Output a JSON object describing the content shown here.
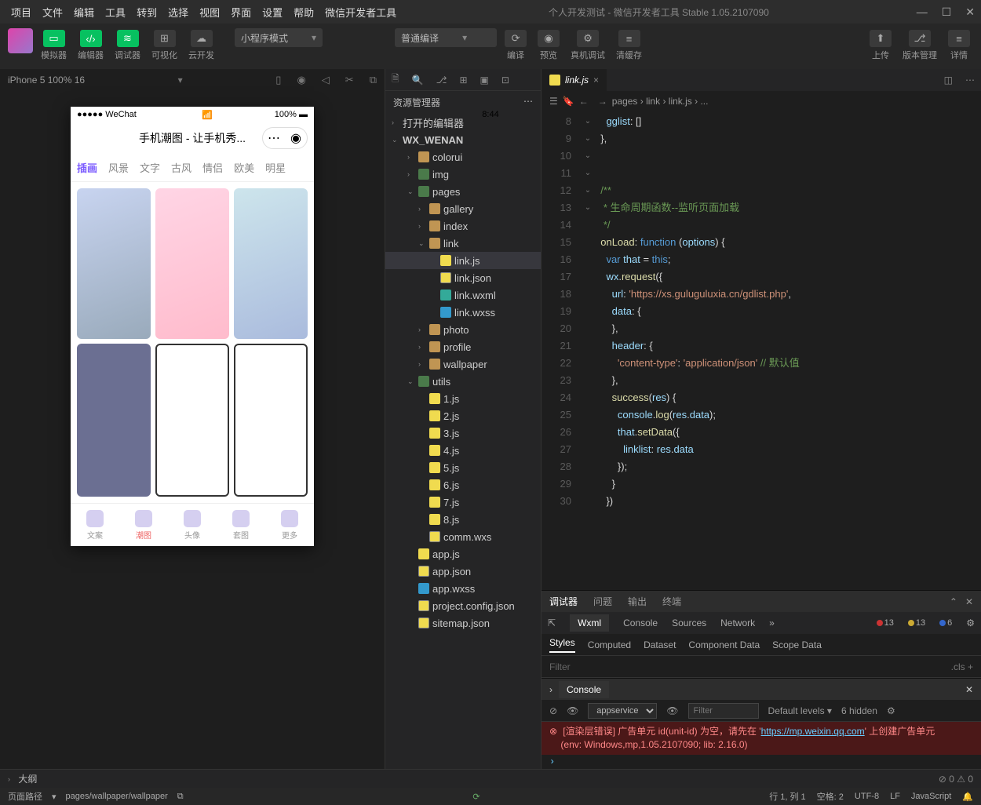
{
  "menus": [
    "项目",
    "文件",
    "编辑",
    "工具",
    "转到",
    "选择",
    "视图",
    "界面",
    "设置",
    "帮助",
    "微信开发者工具"
  ],
  "title": "个人开发测试 - 微信开发者工具 Stable 1.05.2107090",
  "toolbar": {
    "sim": "模拟器",
    "editor": "编辑器",
    "debugger": "调试器",
    "vis": "可视化",
    "cloud": "云开发",
    "mode": "小程序模式",
    "compile_mode": "普通编译",
    "compile": "编译",
    "preview": "预览",
    "remote": "真机调试",
    "clear": "清缓存",
    "upload": "上传",
    "version": "版本管理",
    "detail": "详情"
  },
  "sim": {
    "device": "iPhone 5 100% 16",
    "wechat": "●●●●● WeChat",
    "time": "8:44",
    "batt": "100%",
    "app_title": "手机潮图 - 让手机秀...",
    "tabs": [
      "插画",
      "风景",
      "文字",
      "古风",
      "情侣",
      "欧美",
      "明星"
    ],
    "nav": [
      "文案",
      "潮图",
      "头像",
      "套图",
      "更多"
    ]
  },
  "explorer": {
    "title": "资源管理器",
    "open": "打开的编辑器",
    "root": "WX_WENAN",
    "items": [
      {
        "n": "colorui",
        "t": "fold",
        "d": 2
      },
      {
        "n": "img",
        "t": "foldg",
        "d": 2
      },
      {
        "n": "pages",
        "t": "foldg",
        "d": 2,
        "o": 1
      },
      {
        "n": "gallery",
        "t": "fold",
        "d": 3
      },
      {
        "n": "index",
        "t": "fold",
        "d": 3
      },
      {
        "n": "link",
        "t": "fold",
        "d": 3,
        "o": 1
      },
      {
        "n": "link.js",
        "t": "js",
        "d": 4,
        "sel": 1
      },
      {
        "n": "link.json",
        "t": "json",
        "d": 4
      },
      {
        "n": "link.wxml",
        "t": "wxml",
        "d": 4
      },
      {
        "n": "link.wxss",
        "t": "wxss",
        "d": 4
      },
      {
        "n": "photo",
        "t": "fold",
        "d": 3
      },
      {
        "n": "profile",
        "t": "fold",
        "d": 3
      },
      {
        "n": "wallpaper",
        "t": "fold",
        "d": 3
      },
      {
        "n": "utils",
        "t": "foldg",
        "d": 2,
        "o": 1
      },
      {
        "n": "1.js",
        "t": "js",
        "d": 3
      },
      {
        "n": "2.js",
        "t": "js",
        "d": 3
      },
      {
        "n": "3.js",
        "t": "js",
        "d": 3
      },
      {
        "n": "4.js",
        "t": "js",
        "d": 3
      },
      {
        "n": "5.js",
        "t": "js",
        "d": 3
      },
      {
        "n": "6.js",
        "t": "js",
        "d": 3
      },
      {
        "n": "7.js",
        "t": "js",
        "d": 3
      },
      {
        "n": "8.js",
        "t": "js",
        "d": 3
      },
      {
        "n": "comm.wxs",
        "t": "json",
        "d": 3
      },
      {
        "n": "app.js",
        "t": "js",
        "d": 2
      },
      {
        "n": "app.json",
        "t": "json",
        "d": 2
      },
      {
        "n": "app.wxss",
        "t": "wxss",
        "d": 2
      },
      {
        "n": "project.config.json",
        "t": "json",
        "d": 2
      },
      {
        "n": "sitemap.json",
        "t": "json",
        "d": 2
      }
    ],
    "outline": "大纲"
  },
  "tab": {
    "name": "link.js"
  },
  "crumb": [
    "pages",
    "link",
    "link.js",
    "..."
  ],
  "code": {
    "start": 8,
    "lines": [
      "    <span class='v'>gglist</span>: []",
      "  },",
      "",
      "",
      "  <span class='c'>/**</span>",
      "<span class='c'>   * 生命周期函数--监听页面加载</span>",
      "<span class='c'>   */</span>",
      "  <span class='f'>onLoad</span>: <span class='k'>function</span> (<span class='v'>options</span>) {",
      "    <span class='k'>var</span> <span class='v'>that</span> = <span class='k'>this</span>;",
      "    <span class='v'>wx</span>.<span class='f'>request</span>({",
      "      <span class='v'>url</span>: <span class='s'>'https://xs.guluguluxia.cn/gdlist.php'</span>,",
      "      <span class='v'>data</span>: {",
      "      },",
      "      <span class='v'>header</span>: {",
      "        <span class='s'>'content-type'</span>: <span class='s'>'application/json'</span> <span class='c'>// 默认值</span>",
      "      },",
      "      <span class='f'>success</span>(<span class='v'>res</span>) {",
      "        <span class='v'>console</span>.<span class='f'>log</span>(<span class='v'>res</span>.<span class='v'>data</span>);",
      "        <span class='v'>that</span>.<span class='f'>setData</span>({",
      "          <span class='v'>linklist</span>: <span class='v'>res</span>.<span class='v'>data</span>",
      "        });",
      "      }",
      "    })"
    ]
  },
  "debug": {
    "tabs": [
      "调试器",
      "问题",
      "输出",
      "终端"
    ],
    "dev": [
      "Wxml",
      "Console",
      "Sources",
      "Network"
    ],
    "badges": {
      "err": "13",
      "warn": "13",
      "info": "6"
    },
    "styles": [
      "Styles",
      "Computed",
      "Dataset",
      "Component Data",
      "Scope Data"
    ],
    "filter": "Filter",
    "cls": ".cls"
  },
  "console": {
    "title": "Console",
    "context": "appservice",
    "filter": "Filter",
    "levels": "Default levels",
    "hidden": "6 hidden",
    "err1": "[渲染层错误] 广告单元 id(unit-id) 为空，请先在 '",
    "err_link": "https://mp.weixin.qq.com",
    "err2": "' 上创建广告单元",
    "env": "(env: Windows,mp,1.05.2107090; lib: 2.16.0)"
  },
  "status": {
    "path_label": "页面路径",
    "path": "pages/wallpaper/wallpaper",
    "err": "0",
    "warn": "0",
    "pos": "行 1, 列 1",
    "spaces": "空格: 2",
    "enc": "UTF-8",
    "eol": "LF",
    "lang": "JavaScript"
  }
}
